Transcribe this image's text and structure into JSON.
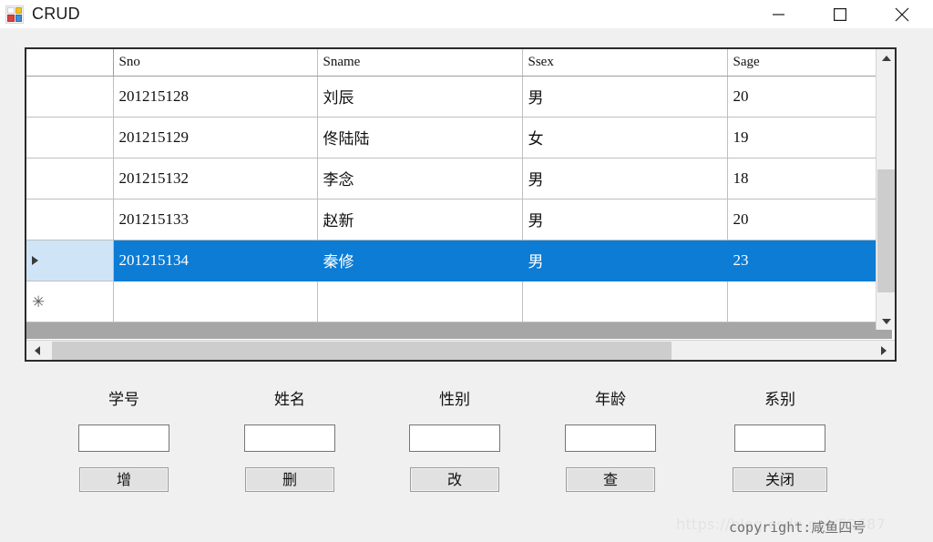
{
  "window": {
    "title": "CRUD",
    "icon": "visual-studio-app-icon",
    "controls": {
      "minimize": "minimize-icon",
      "maximize": "maximize-icon",
      "close": "close-icon"
    }
  },
  "grid": {
    "columns": [
      {
        "key": "selector",
        "label": ""
      },
      {
        "key": "sno",
        "label": "Sno"
      },
      {
        "key": "sname",
        "label": "Sname"
      },
      {
        "key": "ssex",
        "label": "Ssex"
      },
      {
        "key": "sage",
        "label": "Sage"
      }
    ],
    "rows": [
      {
        "marker": "",
        "sno": "201215128",
        "sname": "刘辰",
        "ssex": "男",
        "sage": "20",
        "selected": false
      },
      {
        "marker": "",
        "sno": "201215129",
        "sname": "佟陆陆",
        "ssex": "女",
        "sage": "19",
        "selected": false
      },
      {
        "marker": "",
        "sno": "201215132",
        "sname": "李念",
        "ssex": "男",
        "sage": "18",
        "selected": false
      },
      {
        "marker": "",
        "sno": "201215133",
        "sname": "赵新",
        "ssex": "男",
        "sage": "20",
        "selected": false
      },
      {
        "marker": "▶",
        "sno": "201215134",
        "sname": "秦修",
        "ssex": "男",
        "sage": "23",
        "selected": true
      },
      {
        "marker": "✳",
        "sno": "",
        "sname": "",
        "ssex": "",
        "sage": "",
        "selected": false
      }
    ],
    "selection_color": "#0c7cd5",
    "selector_color": "#cfe4f7",
    "scroll": {
      "vertical": {
        "up": "chevron-up-icon",
        "down": "chevron-down-icon"
      },
      "horizontal": {
        "left": "chevron-left-icon",
        "right": "chevron-right-icon"
      }
    }
  },
  "form": {
    "fields": [
      {
        "label": "学号",
        "value": "",
        "placeholder": "",
        "button": "增"
      },
      {
        "label": "姓名",
        "value": "",
        "placeholder": "",
        "button": "删"
      },
      {
        "label": "性别",
        "value": "",
        "placeholder": "",
        "button": "改"
      },
      {
        "label": "年龄",
        "value": "",
        "placeholder": "",
        "button": "查"
      },
      {
        "label": "系别",
        "value": "",
        "placeholder": "",
        "button": "关闭"
      }
    ]
  },
  "watermark": {
    "url": "https://blog.csdn.net/52687",
    "copyright": "copyright:咸鱼四号"
  }
}
